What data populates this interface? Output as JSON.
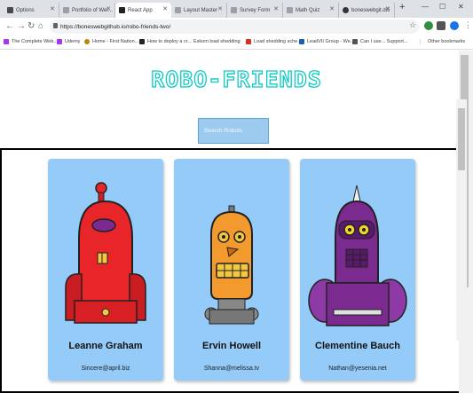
{
  "browser": {
    "tabs": [
      {
        "label": "Options",
        "color": "#4a4a4a"
      },
      {
        "label": "Portfolio of Wer...",
        "color": "#7a7a7a"
      },
      {
        "label": "React App",
        "color": "#222"
      },
      {
        "label": "Layout Master",
        "color": "#7a7a7a"
      },
      {
        "label": "Survey Form",
        "color": "#7a7a7a"
      },
      {
        "label": "Math Quiz",
        "color": "#7a7a7a"
      },
      {
        "label": "boneswebgit.dis",
        "color": "#333"
      }
    ],
    "new_tab": "+",
    "url": "https://boneswebgithub.io/robo-friends-two/",
    "bookmarks": [
      "The Complete Web...",
      "Udemy",
      "Home - First Nation...",
      "How to deploy a cr...",
      "Eskom load shedding",
      "Load shedding sche...",
      "LeadVII Group - We...",
      "Can I use... Support...",
      "Other bookmarks"
    ]
  },
  "page": {
    "title": "ROBO-FRIENDS",
    "search_placeholder": "Search Robots"
  },
  "robots": [
    {
      "name": "Leanne Graham",
      "email": "Sincere@april.biz",
      "body_color": "#e8262a"
    },
    {
      "name": "Ervin Howell",
      "email": "Shanna@melissa.tv",
      "body_color": "#f29a2e"
    },
    {
      "name": "Clementine Bauch",
      "email": "Nathan@yesenia.net",
      "body_color": "#7b2a90"
    }
  ]
}
